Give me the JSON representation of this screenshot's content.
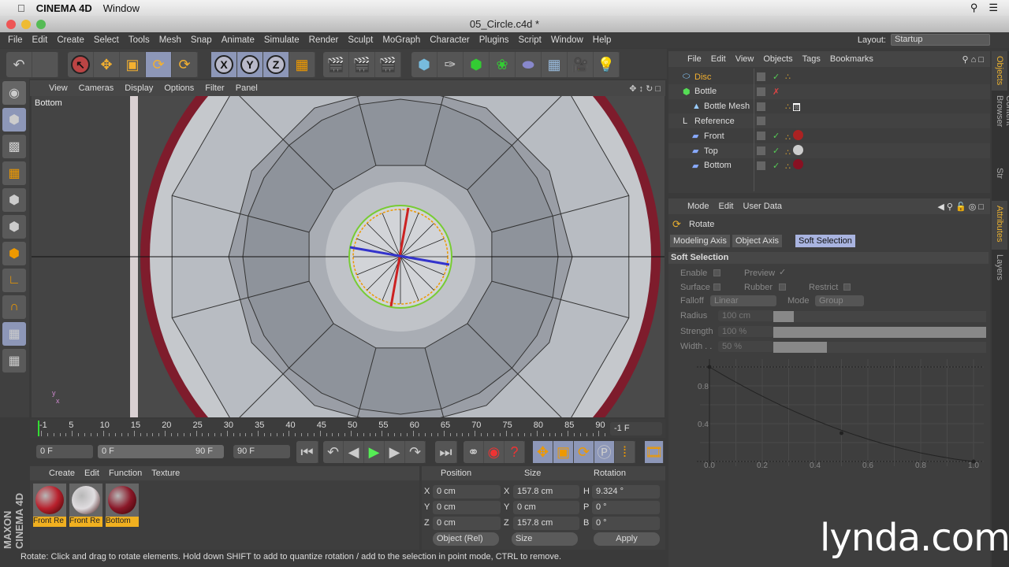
{
  "mac_menubar": {
    "app": "CINEMA 4D",
    "items": [
      "Window"
    ]
  },
  "window": {
    "title": "05_Circle.c4d *"
  },
  "menu": [
    "File",
    "Edit",
    "Create",
    "Select",
    "Tools",
    "Mesh",
    "Snap",
    "Animate",
    "Simulate",
    "Render",
    "Sculpt",
    "MoGraph",
    "Character",
    "Plugins",
    "Script",
    "Window",
    "Help"
  ],
  "layout": {
    "label": "Layout:",
    "value": "Startup"
  },
  "toolbar": {
    "x": "X",
    "y": "Y",
    "z": "Z"
  },
  "viewport": {
    "menu": [
      "View",
      "Cameras",
      "Display",
      "Options",
      "Filter",
      "Panel"
    ],
    "name": "Bottom"
  },
  "timeline": {
    "ticks": [
      "-1",
      "5",
      "10",
      "15",
      "20",
      "25",
      "30",
      "35",
      "40",
      "45",
      "50",
      "55",
      "60",
      "65",
      "70",
      "75",
      "80",
      "85",
      "90"
    ],
    "current": "-1 F"
  },
  "transport": {
    "start": "0 F",
    "range_start": "0 F",
    "range_end": "90 F",
    "end": "90 F"
  },
  "materials": {
    "menu": [
      "Create",
      "Edit",
      "Function",
      "Texture"
    ],
    "items": [
      {
        "name": "Front Re",
        "color": "#b8202c"
      },
      {
        "name": "Front Re",
        "color": "#e0dde0"
      },
      {
        "name": "Bottom",
        "color": "#8a1828"
      }
    ]
  },
  "coordinates": {
    "headers": [
      "Position",
      "Size",
      "Rotation"
    ],
    "rows": [
      {
        "axis": "X",
        "pos": "0 cm",
        "size_axis": "X",
        "size": "157.8 cm",
        "rot_axis": "H",
        "rot": "9.324 °"
      },
      {
        "axis": "Y",
        "pos": "0 cm",
        "size_axis": "Y",
        "size": "0 cm",
        "rot_axis": "P",
        "rot": "0 °"
      },
      {
        "axis": "Z",
        "pos": "0 cm",
        "size_axis": "Z",
        "size": "157.8 cm",
        "rot_axis": "B",
        "rot": "0 °"
      }
    ],
    "mode": "Object (Rel)",
    "size_mode": "Size",
    "apply": "Apply"
  },
  "status": "Rotate: Click and drag to rotate elements. Hold down SHIFT to add to quantize rotation / add to the selection in point mode, CTRL to remove.",
  "objects": {
    "menu": [
      "File",
      "Edit",
      "View",
      "Objects",
      "Tags",
      "Bookmarks"
    ],
    "items": [
      {
        "name": "Disc",
        "active": true
      },
      {
        "name": "Bottle"
      },
      {
        "name": "Bottle Mesh"
      },
      {
        "name": "Reference"
      },
      {
        "name": "Front"
      },
      {
        "name": "Top"
      },
      {
        "name": "Bottom"
      }
    ]
  },
  "attributes": {
    "menu": [
      "Mode",
      "Edit",
      "User Data"
    ],
    "tool": "Rotate",
    "tabs": [
      "Modeling Axis",
      "Object Axis",
      "Soft Selection"
    ],
    "active_tab": "Soft Selection",
    "section": "Soft Selection",
    "enable": "Enable",
    "preview": "Preview",
    "surface": "Surface",
    "rubber": "Rubber",
    "restrict": "Restrict",
    "falloff": "Falloff",
    "falloff_value": "Linear",
    "mode": "Mode",
    "mode_value": "Group",
    "radius": "Radius",
    "radius_value": "100 cm",
    "strength": "Strength",
    "strength_value": "100 %",
    "strength_level": 1.0,
    "width": "Width . .",
    "width_value": "50 %",
    "width_level": 0.5,
    "graph_y": [
      "0.8",
      "0.4"
    ],
    "graph_x": [
      "0.0",
      "0.2",
      "0.4",
      "0.6",
      "0.8",
      "1.0"
    ]
  },
  "side_tabs": [
    "Objects",
    "Content Browser",
    "Str",
    "Attributes",
    "Layers"
  ],
  "brand": {
    "lynda": "lynda.com",
    "maxon": "MAXON CINEMA 4D"
  }
}
